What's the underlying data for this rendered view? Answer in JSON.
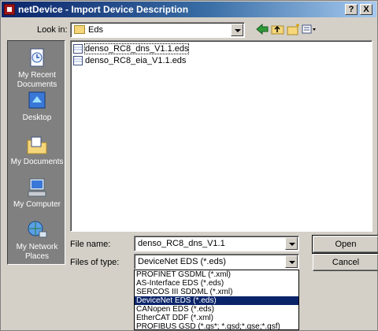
{
  "window": {
    "title": "netDevice - Import Device Description",
    "help_label": "?",
    "close_label": "X"
  },
  "toolbar": {
    "look_in_label": "Look in:",
    "look_in_value": "Eds",
    "icons": [
      "back-arrow-icon",
      "up-folder-icon",
      "new-folder-icon",
      "view-menu-icon"
    ]
  },
  "places": [
    {
      "label": "My Recent Documents",
      "icon": "recent-documents-icon"
    },
    {
      "label": "Desktop",
      "icon": "desktop-icon"
    },
    {
      "label": "My Documents",
      "icon": "my-documents-icon"
    },
    {
      "label": "My Computer",
      "icon": "my-computer-icon"
    },
    {
      "label": "My Network Places",
      "icon": "network-places-icon"
    }
  ],
  "files": [
    {
      "name": "denso_RC8_dns_V1.1.eds",
      "selected": true
    },
    {
      "name": "denso_RC8_eia_V1.1.eds",
      "selected": false
    }
  ],
  "filename": {
    "label": "File name:",
    "value": "denso_RC8_dns_V1.1"
  },
  "filetype": {
    "label": "Files of type:",
    "value": "DeviceNet EDS (*.eds)",
    "options": [
      "PROFINET GSDML (*.xml)",
      "AS-Interface EDS (*.eds)",
      "SERCOS III SDDML (*.xml)",
      "DeviceNet EDS (*.eds)",
      "CANopen EDS (*.eds)",
      "EtherCAT DDF (*.xml)",
      "PROFIBUS GSD (*.gs*; *.gsd;*.gse;*.gsf)"
    ],
    "selected_index": 3
  },
  "buttons": {
    "open": "Open",
    "cancel": "Cancel"
  },
  "colors": {
    "title_start": "#0a246a",
    "title_end": "#a6caf0",
    "selection": "#0a246a",
    "face": "#d4d0c8"
  }
}
